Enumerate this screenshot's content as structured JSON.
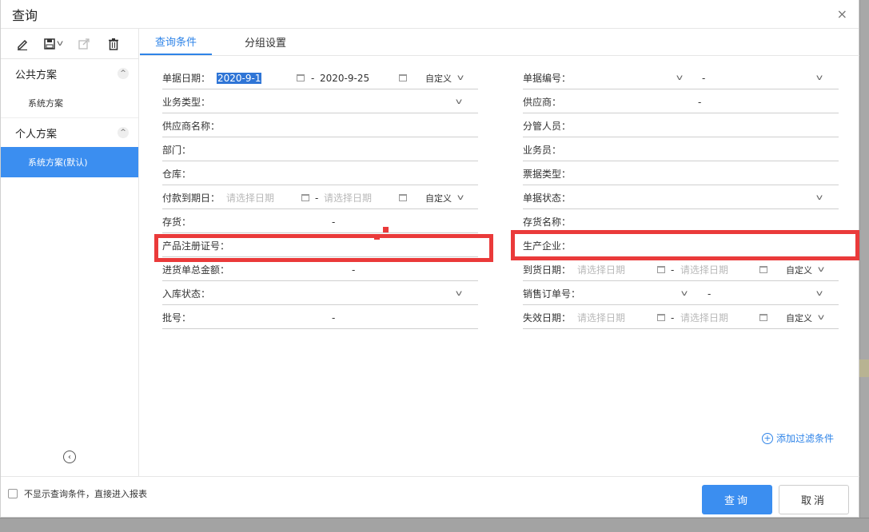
{
  "dialog": {
    "title": "查询",
    "close": "×"
  },
  "sidebar": {
    "groups": [
      {
        "label": "公共方案",
        "plans": [
          "系统方案"
        ]
      },
      {
        "label": "个人方案",
        "plans": [
          "系统方案(默认)"
        ]
      }
    ],
    "collapse": "‹"
  },
  "tabs": [
    "查询条件",
    "分组设置"
  ],
  "left_fields": {
    "doc_date": {
      "label": "单据日期：",
      "from": "2020-9-1",
      "to": "2020-9-25",
      "range_sep": "-",
      "custom": "自定义"
    },
    "biz_type": {
      "label": "业务类型："
    },
    "supplier_name": {
      "label": "供应商名称："
    },
    "dept": {
      "label": "部门："
    },
    "warehouse": {
      "label": "仓库："
    },
    "due_date": {
      "label": "付款到期日：",
      "from_ph": "请选择日期",
      "to_ph": "请选择日期",
      "range_sep": "-",
      "custom": "自定义"
    },
    "stock": {
      "label": "存货：",
      "range_sep": "-"
    },
    "reg_no": {
      "label": "产品注册证号："
    },
    "amount": {
      "label": "进货单总金额：",
      "range_sep": "-"
    },
    "in_status": {
      "label": "入库状态："
    },
    "batch": {
      "label": "批号：",
      "range_sep": "-"
    }
  },
  "right_fields": {
    "doc_no": {
      "label": "单据编号：",
      "range_sep": "-"
    },
    "supplier": {
      "label": "供应商：",
      "range_sep": "-"
    },
    "manager": {
      "label": "分管人员："
    },
    "salesman": {
      "label": "业务员："
    },
    "invoice_type": {
      "label": "票据类型："
    },
    "doc_status": {
      "label": "单据状态："
    },
    "stock_name": {
      "label": "存货名称："
    },
    "maker": {
      "label": "生产企业："
    },
    "arrival_date": {
      "label": "到货日期：",
      "from_ph": "请选择日期",
      "to_ph": "请选择日期",
      "range_sep": "-",
      "custom": "自定义"
    },
    "so_no": {
      "label": "销售订单号：",
      "range_sep": "-"
    },
    "expiry": {
      "label": "失效日期：",
      "from_ph": "请选择日期",
      "to_ph": "请选择日期",
      "range_sep": "-",
      "custom": "自定义"
    }
  },
  "add_filter": "添加过滤条件",
  "footer": {
    "skip_label": "不显示查询条件，直接进入报表",
    "query_btn": "查询",
    "cancel_btn": "取消"
  },
  "colors": {
    "accent": "#3b8ef0",
    "highlight_box": "#ea3a3a"
  }
}
